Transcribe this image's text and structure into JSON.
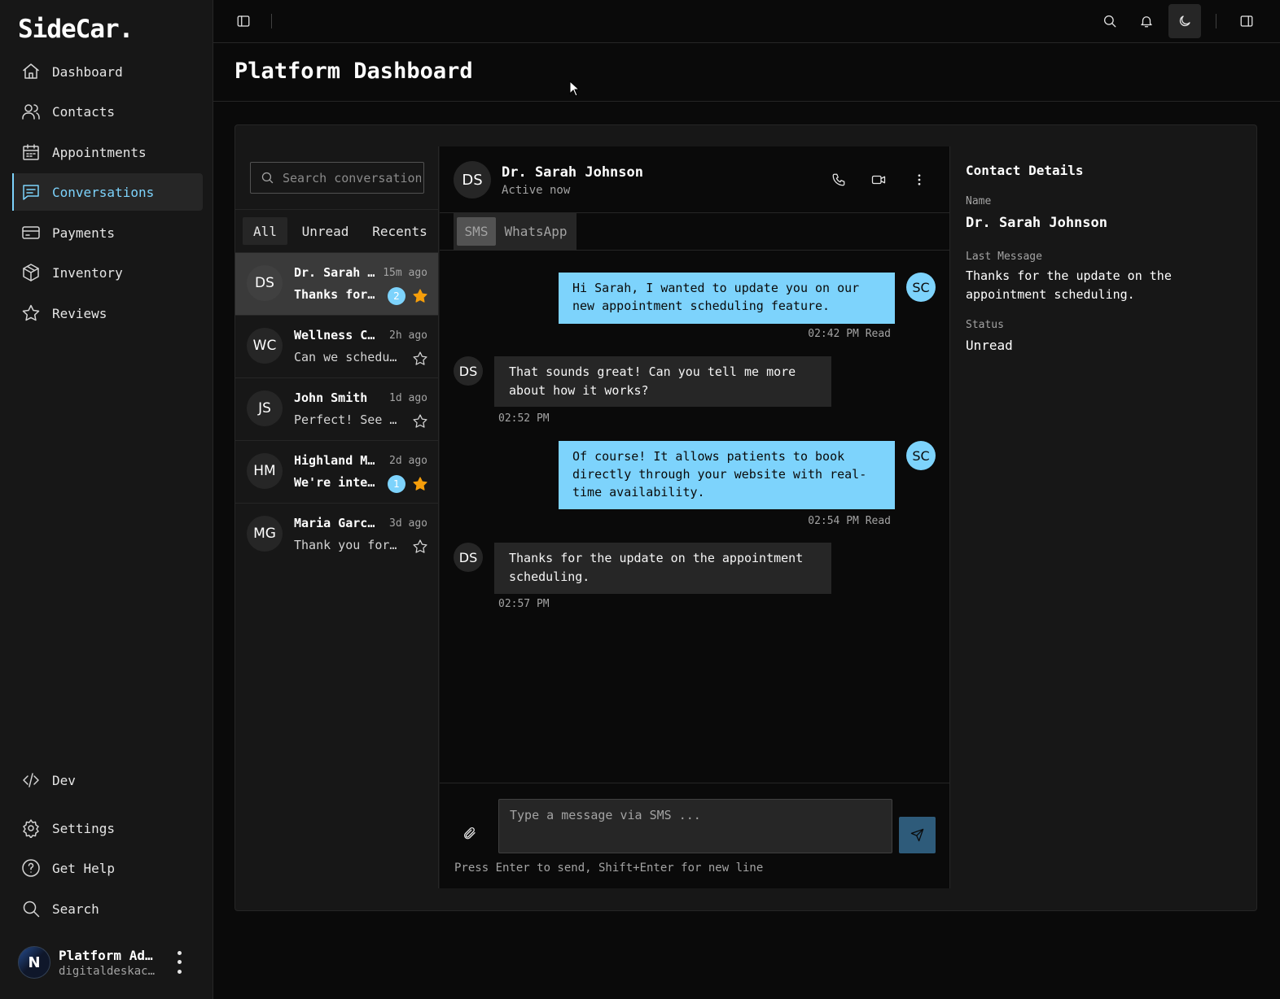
{
  "app": {
    "logo": "SideCar."
  },
  "sidebar": {
    "items": [
      {
        "label": "Dashboard",
        "icon": "home-icon"
      },
      {
        "label": "Contacts",
        "icon": "users-icon"
      },
      {
        "label": "Appointments",
        "icon": "calendar-icon"
      },
      {
        "label": "Conversations",
        "icon": "message-icon",
        "active": true
      },
      {
        "label": "Payments",
        "icon": "credit-card-icon"
      },
      {
        "label": "Inventory",
        "icon": "package-icon"
      },
      {
        "label": "Reviews",
        "icon": "star-icon"
      }
    ],
    "bottom_items": [
      {
        "label": "Dev",
        "icon": "code-icon"
      },
      {
        "label": "Settings",
        "icon": "gear-icon"
      },
      {
        "label": "Get Help",
        "icon": "help-icon"
      },
      {
        "label": "Search",
        "icon": "search-icon"
      }
    ],
    "user": {
      "name": "Platform Ad…",
      "email": "digitaldeskac…",
      "avatar_letter": "N"
    }
  },
  "header": {
    "title": "Platform Dashboard"
  },
  "conversations": {
    "search_placeholder": "Search conversations...",
    "filters": [
      "All",
      "Unread",
      "Recents"
    ],
    "active_filter": "All",
    "items": [
      {
        "initials": "DS",
        "name": "Dr. Sarah Johnson",
        "time": "15m ago",
        "preview": "Thanks for the update on the appointment scheduling.",
        "unread": "2",
        "starred": true,
        "active": true
      },
      {
        "initials": "WC",
        "name": "Wellness Center",
        "time": "2h ago",
        "preview": "Can we schedule a call?",
        "unread": "",
        "starred": false
      },
      {
        "initials": "JS",
        "name": "John Smith",
        "time": "1d ago",
        "preview": "Perfect! See you then.",
        "unread": "",
        "starred": false
      },
      {
        "initials": "HM",
        "name": "Highland Medical",
        "time": "2d ago",
        "preview": "We're interested in your services.",
        "unread": "1",
        "starred": true
      },
      {
        "initials": "MG",
        "name": "Maria Garcia",
        "time": "3d ago",
        "preview": "Thank you for your help!",
        "unread": "",
        "starred": false
      }
    ]
  },
  "chat": {
    "contact": {
      "initials": "DS",
      "name": "Dr. Sarah Johnson",
      "status": "Active now"
    },
    "channels": [
      "SMS",
      "WhatsApp"
    ],
    "active_channel": "SMS",
    "messages": [
      {
        "direction": "out",
        "avatar": "SC",
        "text": "Hi Sarah, I wanted to update you on our new appointment scheduling feature.",
        "meta": "02:42 PM Read"
      },
      {
        "direction": "in",
        "avatar": "DS",
        "text": "That sounds great! Can you tell me more about how it works?",
        "meta": "02:52 PM"
      },
      {
        "direction": "out",
        "avatar": "SC",
        "text": "Of course! It allows patients to book directly through your website with real-time availability.",
        "meta": "02:54 PM Read"
      },
      {
        "direction": "in",
        "avatar": "DS",
        "text": "Thanks for the update on the appointment scheduling.",
        "meta": "02:57 PM"
      }
    ],
    "composer": {
      "placeholder": "Type a message via SMS ...",
      "hint": "Press Enter to send, Shift+Enter for new line"
    }
  },
  "details": {
    "title": "Contact Details",
    "name_label": "Name",
    "name_value": "Dr. Sarah Johnson",
    "last_message_label": "Last Message",
    "last_message_value": "Thanks for the update on the appointment scheduling.",
    "status_label": "Status",
    "status_value": "Unread"
  },
  "colors": {
    "accent": "#7dd3fc",
    "star": "#f59e0b",
    "background": "#0a0a0a",
    "panel": "#171717"
  }
}
